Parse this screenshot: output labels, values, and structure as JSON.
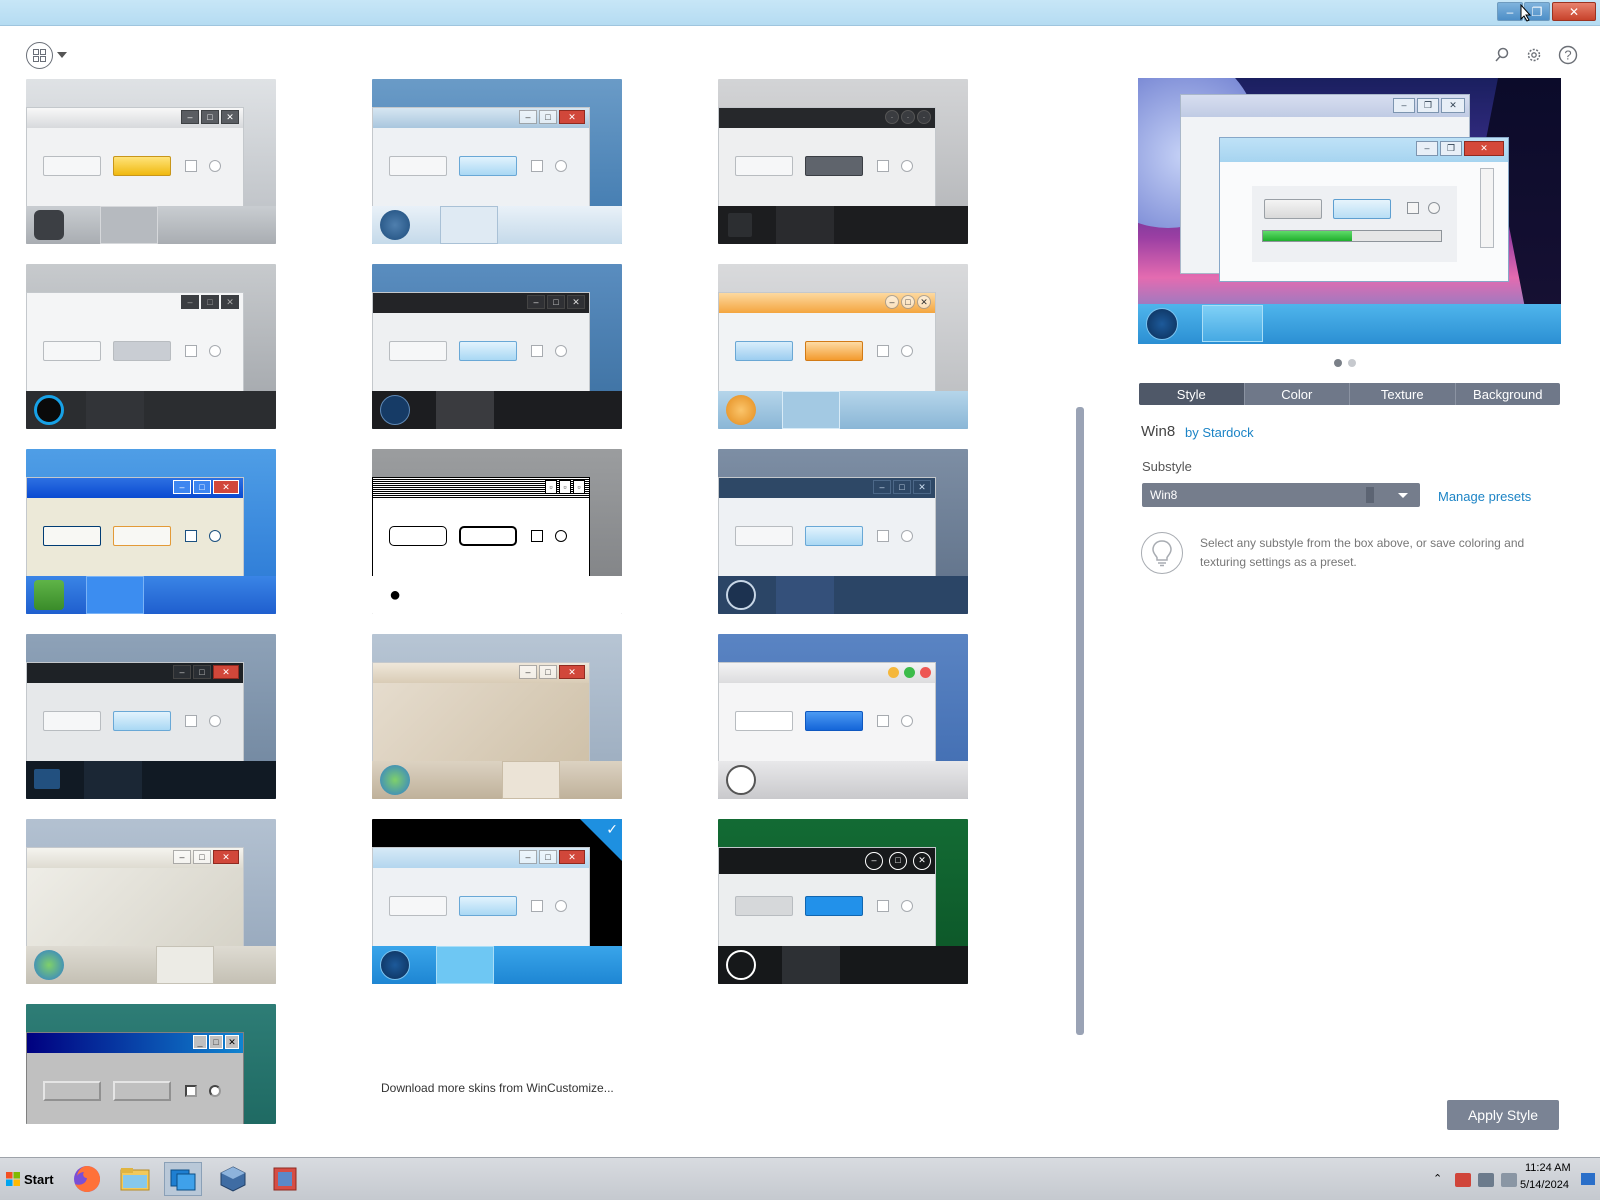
{
  "window": {
    "title": "",
    "controls": {
      "minimize": "–",
      "maximize": "❐",
      "close": "✕"
    }
  },
  "toolbar": {
    "layout_icon": "layout-grid-icon",
    "search_icon": "search-icon",
    "settings_icon": "gear-icon",
    "help_icon": "help-icon"
  },
  "skins": [
    {
      "id": "skin-1",
      "theme": "silver-chrome",
      "selected": false
    },
    {
      "id": "skin-2",
      "theme": "blue-aero",
      "selected": false
    },
    {
      "id": "skin-3",
      "theme": "dark-gray",
      "selected": false
    },
    {
      "id": "skin-4",
      "theme": "light-modern",
      "selected": false
    },
    {
      "id": "skin-5",
      "theme": "black-titlebar",
      "selected": false
    },
    {
      "id": "skin-6",
      "theme": "orange-vista",
      "selected": false
    },
    {
      "id": "skin-7",
      "theme": "xp-luna",
      "selected": false
    },
    {
      "id": "skin-8",
      "theme": "classic-mac",
      "selected": false
    },
    {
      "id": "skin-9",
      "theme": "navy-flat",
      "selected": false
    },
    {
      "id": "skin-10",
      "theme": "dark-aero",
      "selected": false
    },
    {
      "id": "skin-11",
      "theme": "stone-texture",
      "selected": false
    },
    {
      "id": "skin-12",
      "theme": "mac-os-x",
      "selected": false
    },
    {
      "id": "skin-13",
      "theme": "paper-texture",
      "selected": false
    },
    {
      "id": "skin-14",
      "theme": "win8",
      "selected": true
    },
    {
      "id": "skin-15",
      "theme": "green-dark",
      "selected": false
    },
    {
      "id": "skin-16",
      "theme": "win2000-classic",
      "selected": false
    }
  ],
  "download_link": "Download more skins from WinCustomize...",
  "preview": {
    "controls": {
      "minimize": "–",
      "maximize": "❐",
      "close": "✕"
    },
    "progress": 0.5,
    "pager": {
      "pages": 2,
      "current": 1
    }
  },
  "tabs": [
    "Style",
    "Color",
    "Texture",
    "Background"
  ],
  "active_tab": "Style",
  "skin_info": {
    "name": "Win8",
    "author": "by Stardock",
    "substyle_label": "Substyle",
    "substyle_value": "Win8",
    "manage_presets": "Manage presets",
    "tip": "Select any substyle from the box above, or save coloring and texturing settings as a preset."
  },
  "apply_button": "Apply Style",
  "taskbar": {
    "start_label": "Start",
    "apps": [
      "firefox-icon",
      "file-explorer-icon",
      "windowblinds-icon",
      "virtualbox-icon",
      "registry-editor-icon"
    ],
    "clock_time": "11:24 AM",
    "clock_date": "5/14/2024"
  },
  "colors": {
    "accent_link": "#1c84c6",
    "tab_bar": "#6f7889",
    "selected_badge": "#1e90e0"
  }
}
